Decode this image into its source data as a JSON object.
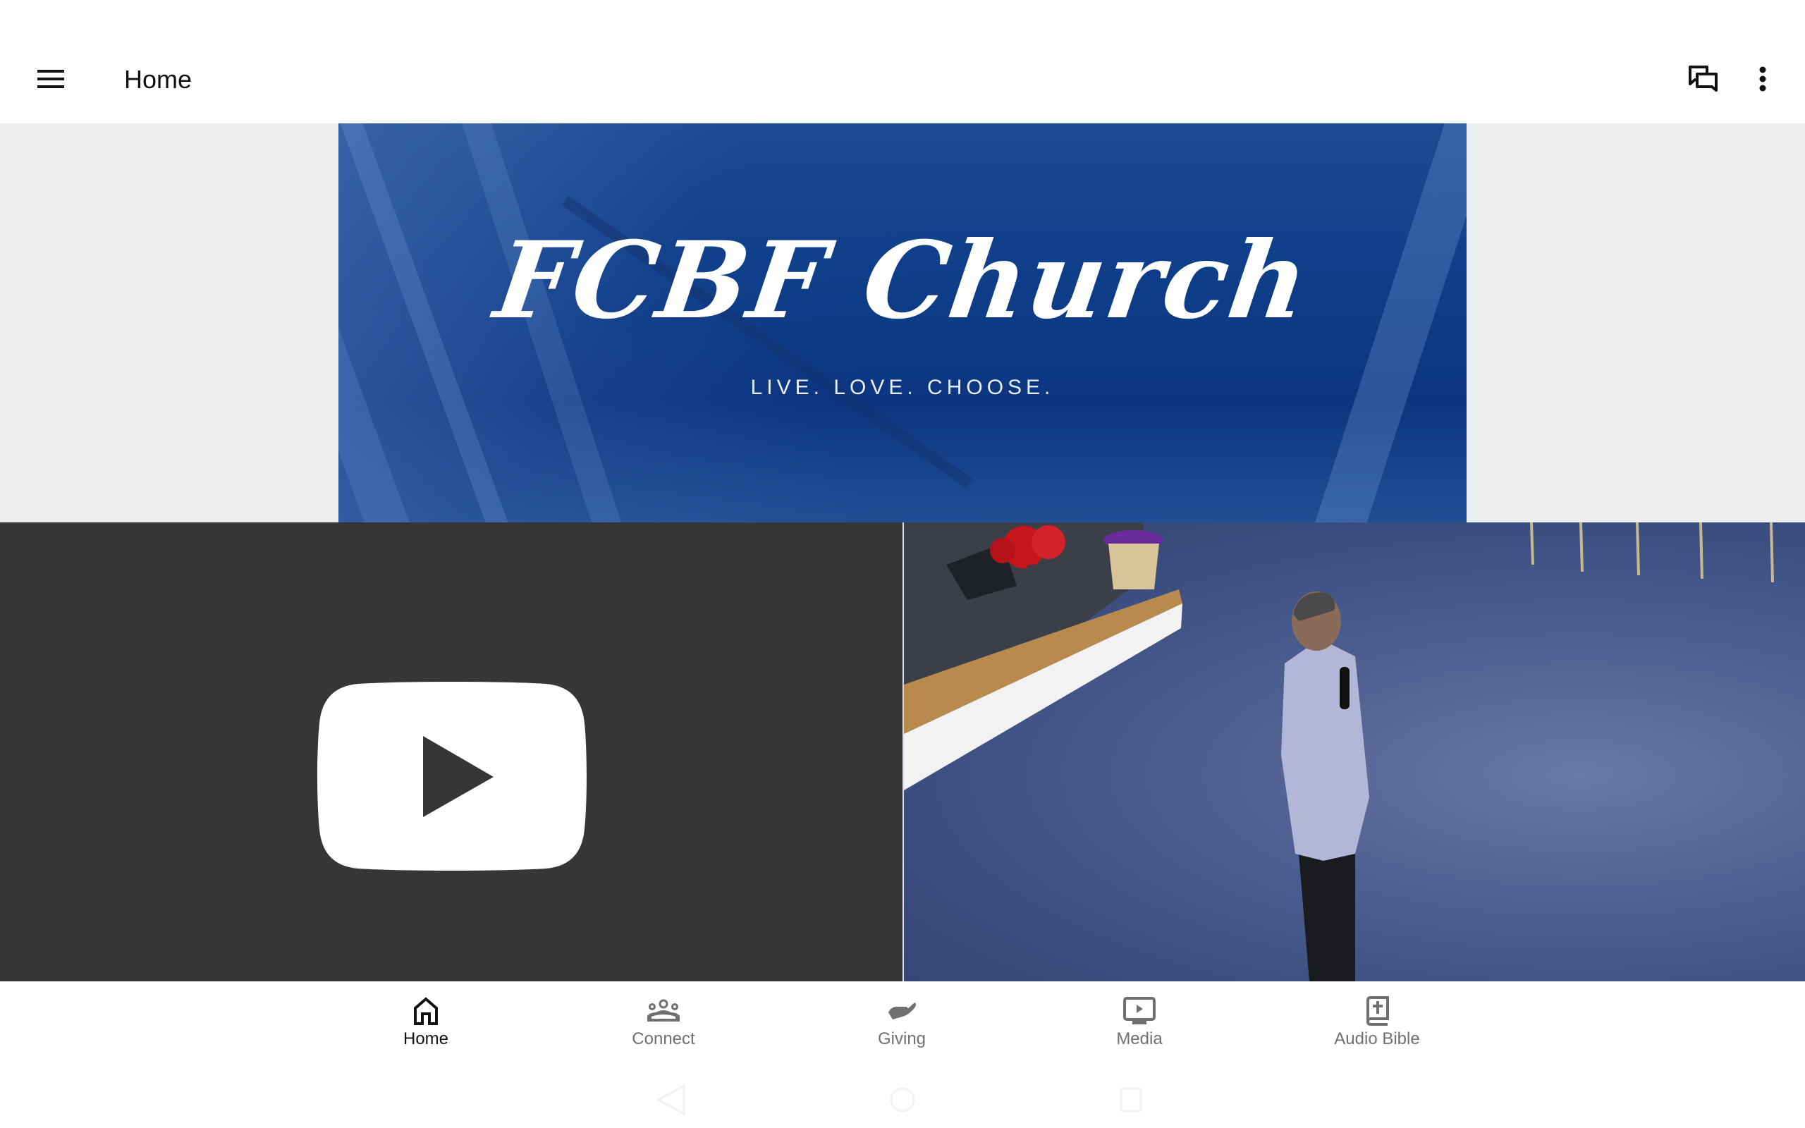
{
  "appbar": {
    "title": "Home",
    "menu_icon": "hamburger-menu-icon",
    "actions": [
      {
        "name": "chat",
        "icon": "chat-bubbles-icon"
      },
      {
        "name": "more",
        "icon": "more-vertical-icon"
      }
    ]
  },
  "banner": {
    "title": "FCBF Church",
    "tagline": "LIVE. LOVE. CHOOSE."
  },
  "tiles": [
    {
      "name": "youtube",
      "icon": "youtube-play-icon",
      "background": "#363636"
    },
    {
      "name": "live-video",
      "description": "Video thumbnail of speaker on stage"
    }
  ],
  "bottom_nav": {
    "items": [
      {
        "label": "Home",
        "icon": "home-icon",
        "active": true
      },
      {
        "label": "Connect",
        "icon": "people-group-icon",
        "active": false
      },
      {
        "label": "Giving",
        "icon": "giving-hand-icon",
        "active": false
      },
      {
        "label": "Media",
        "icon": "tv-play-icon",
        "active": false
      },
      {
        "label": "Audio Bible",
        "icon": "bible-book-icon",
        "active": false
      }
    ],
    "active_color": "#111111",
    "inactive_color": "#707070"
  },
  "system_nav": [
    "back",
    "home",
    "recents"
  ]
}
